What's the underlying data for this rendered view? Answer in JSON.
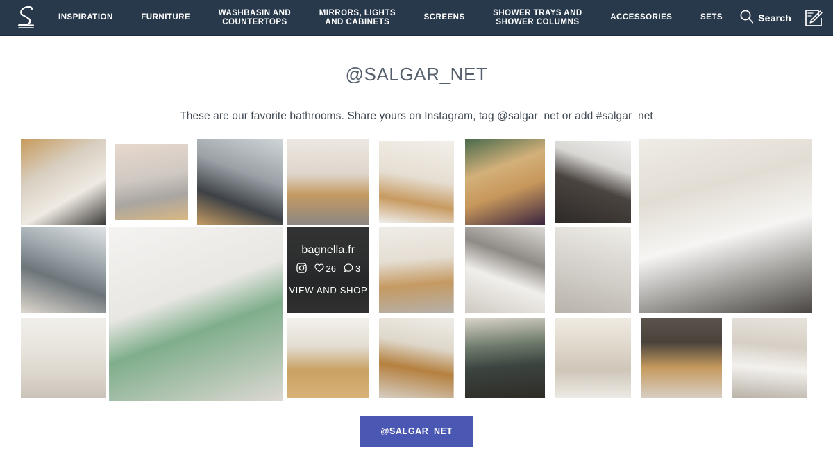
{
  "nav": {
    "logo_icon": "salgar-s-logo",
    "items": [
      {
        "label": "INSPIRATION",
        "name": "nav-item-inspiration"
      },
      {
        "label": "FURNITURE",
        "name": "nav-item-furniture"
      },
      {
        "label": "WASHBASIN AND\nCOUNTERTOPS",
        "name": "nav-item-washbasin-and-countertops"
      },
      {
        "label": "MIRRORS, LIGHTS\nAND CABINETS",
        "name": "nav-item-mirrors-lights-and-cabinets"
      },
      {
        "label": "SCREENS",
        "name": "nav-item-screens"
      },
      {
        "label": "SHOWER TRAYS AND\nSHOWER COLUMNS",
        "name": "nav-item-shower-trays-and-shower-columns"
      },
      {
        "label": "ACCESSORIES",
        "name": "nav-item-accessories"
      },
      {
        "label": "SETS",
        "name": "nav-item-sets"
      }
    ],
    "search_label": "Search",
    "search_icon": "search-icon",
    "blog_icon": "pencil-edit-icon",
    "background_color": "#27394b"
  },
  "main": {
    "title": "@SALGAR_NET",
    "subtitle": "These are our favorite bathrooms. Share yours on Instagram, tag @salgar_net or add #salgar_net"
  },
  "gallery": {
    "overlay": {
      "username": "bagnella.fr",
      "instagram_icon": "instagram-icon",
      "like_icon": "heart-icon",
      "likes": "26",
      "comment_icon": "comment-bubble-icon",
      "comments": "3",
      "shop_label": "VIEW AND SHOP"
    },
    "tiles": [
      {
        "name": "gallery-tile-1",
        "alt": "Bathroom with wooden vanity, round mirror and washing machine"
      },
      {
        "name": "gallery-tile-2",
        "alt": "Grey vanity unit with tall mirror"
      },
      {
        "name": "gallery-tile-3",
        "alt": "Shower screen with round backlit mirror and black frame vanity"
      },
      {
        "name": "gallery-tile-4",
        "alt": "Oval backlit mirror above wooden vanity"
      },
      {
        "name": "gallery-tile-5",
        "alt": "White bathroom with wooden drawers and toilet"
      },
      {
        "name": "gallery-tile-6",
        "alt": "Wooden countertop with plants and purple bottles"
      },
      {
        "name": "gallery-tile-7",
        "alt": "Dark vanity unit with white basin"
      },
      {
        "name": "gallery-tile-8-large",
        "alt": "Wide white countertop basin on dark vanity with mirror"
      },
      {
        "name": "gallery-tile-9",
        "alt": "Grey vanity with shower and window"
      },
      {
        "name": "gallery-tile-10-large",
        "alt": "Close-up of white countertop basin with tap and plant"
      },
      {
        "name": "gallery-tile-11-overlay",
        "alt": "Instagram post overlay tile"
      },
      {
        "name": "gallery-tile-12",
        "alt": "Narrow bathroom corridor with shower"
      },
      {
        "name": "gallery-tile-13",
        "alt": "Wooden vanity with arch mirror and cat"
      },
      {
        "name": "gallery-tile-14",
        "alt": "Hand under wall mounted tap on stone basin"
      },
      {
        "name": "gallery-tile-15",
        "alt": "Small bathroom with mirror, toilet and white vanity"
      },
      {
        "name": "gallery-tile-16",
        "alt": "Wooden vanity with black tap and marble tiles"
      },
      {
        "name": "gallery-tile-17",
        "alt": "Solid wood block washbasin countertop"
      },
      {
        "name": "gallery-tile-18",
        "alt": "Bathroom with black framed glass partition"
      },
      {
        "name": "gallery-tile-19",
        "alt": "Vessel basin on light wood vanity with plant"
      },
      {
        "name": "gallery-tile-20",
        "alt": "Triple mirror vanity with pendant lights"
      },
      {
        "name": "gallery-tile-21",
        "alt": "White drawer vanity with mirror and stool"
      }
    ]
  },
  "footer": {
    "cta_label": "@SALGAR_NET",
    "cta_color": "#4a57b3"
  }
}
